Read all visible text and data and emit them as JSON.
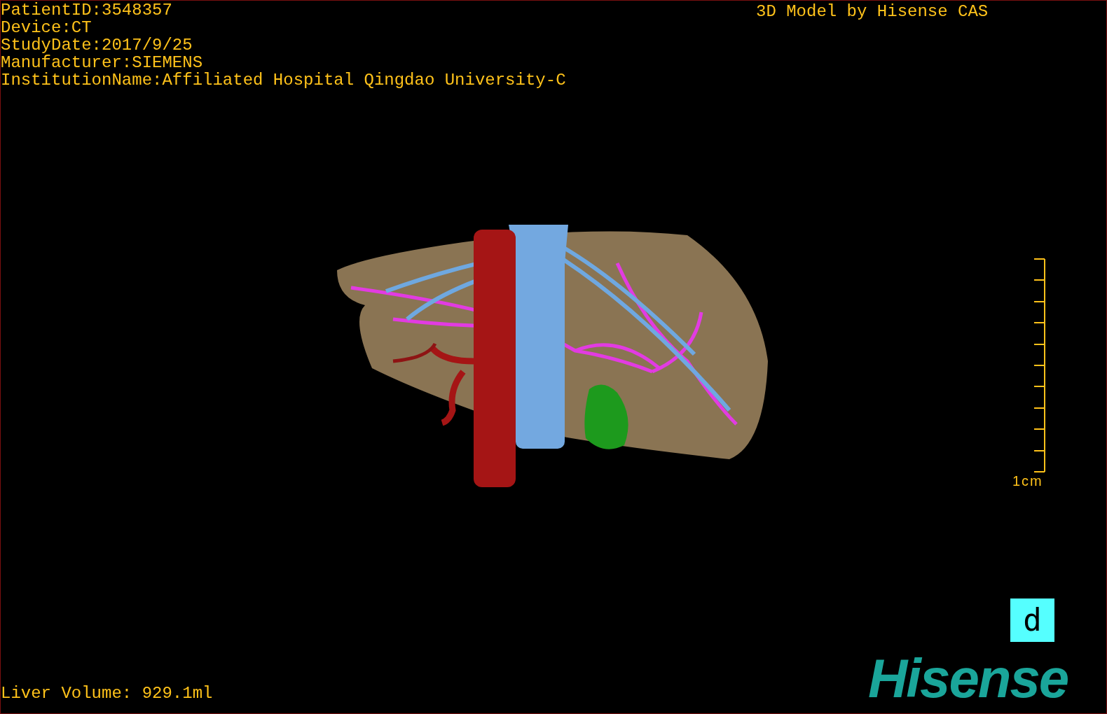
{
  "info_lines": [
    "PatientID:3548357",
    "Device:CT",
    "StudyDate:2017/9/25",
    "Manufacturer:SIEMENS",
    "InstitutionName:Affiliated Hospital Qingdao University-C"
  ],
  "title": "3D Model by Hisense CAS",
  "scale_label": "1cm",
  "view_button": "d",
  "logo": "Hisense",
  "liver_volume": "Liver Volume: 929.1ml"
}
